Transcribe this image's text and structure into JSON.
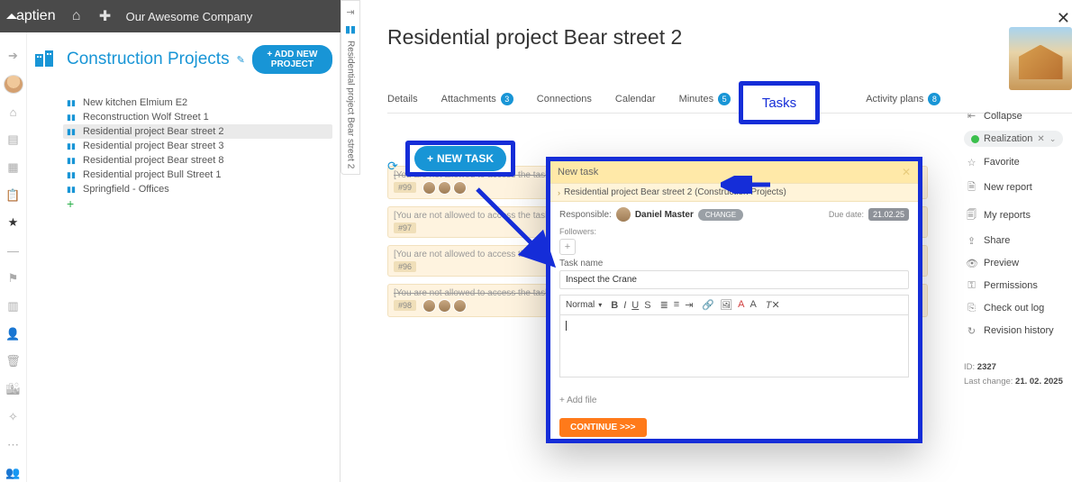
{
  "app": {
    "brand": "aptien",
    "org": "Our Awesome Company"
  },
  "leftpanel": {
    "title": "Construction Projects",
    "add_label": "+ ADD NEW PROJECT",
    "projects": [
      "New kitchen Elmium E2",
      "Reconstruction Wolf Street 1",
      "Residential project Bear street 2",
      "Residential project Bear street 3",
      "Residential project Bear street 8",
      "Residential project Bull Street 1",
      "Springfield - Offices"
    ],
    "selected_index": 2
  },
  "vtab": {
    "label": "Residential project Bear street 2"
  },
  "page": {
    "title": "Residential project Bear street 2"
  },
  "tabs": {
    "items": [
      {
        "label": "Details"
      },
      {
        "label": "Attachments",
        "badge": "3"
      },
      {
        "label": "Connections"
      },
      {
        "label": "Calendar"
      },
      {
        "label": "Minutes",
        "badge": "5"
      },
      {
        "label": "Tasks",
        "active": true
      },
      {
        "label": "Activity plans",
        "badge": "8"
      }
    ]
  },
  "callouts": {
    "tasks": "Tasks",
    "new_task_btn": "NEW TASK"
  },
  "strips": [
    {
      "text": "[You are not allowed to access the task]",
      "id": "#99",
      "avatars": 3,
      "strike": true
    },
    {
      "text": "[You are not allowed to access the task]",
      "id": "#97",
      "avatars": 0
    },
    {
      "text": "[You are not allowed to access the task]",
      "id": "#96",
      "avatars": 0
    },
    {
      "text": "[You are not allowed to access the task]",
      "id": "#98",
      "avatars": 3,
      "strike": true
    }
  ],
  "modal": {
    "title": "New task",
    "crumb": "Residential project Bear street 2 (Construction Projects)",
    "responsible_label": "Responsible:",
    "responsible_name": "Daniel Master",
    "change": "CHANGE",
    "due_label": "Due date:",
    "due_value": "21.02.25",
    "followers_label": "Followers:",
    "taskname_label": "Task name",
    "taskname_value": "Inspect the Crane",
    "format_label": "Normal",
    "add_file": "+ Add file",
    "continue": "CONTINUE >>>"
  },
  "right": {
    "collapse": "Collapse",
    "status": "Realization",
    "favorite": "Favorite",
    "new_report": "New report",
    "my_reports": "My reports",
    "share": "Share",
    "preview": "Preview",
    "permissions": "Permissions",
    "checkout": "Check out log",
    "revision": "Revision history",
    "id_label": "ID:",
    "id_value": "2327",
    "lc_label": "Last change:",
    "lc_value": "21. 02. 2025"
  }
}
